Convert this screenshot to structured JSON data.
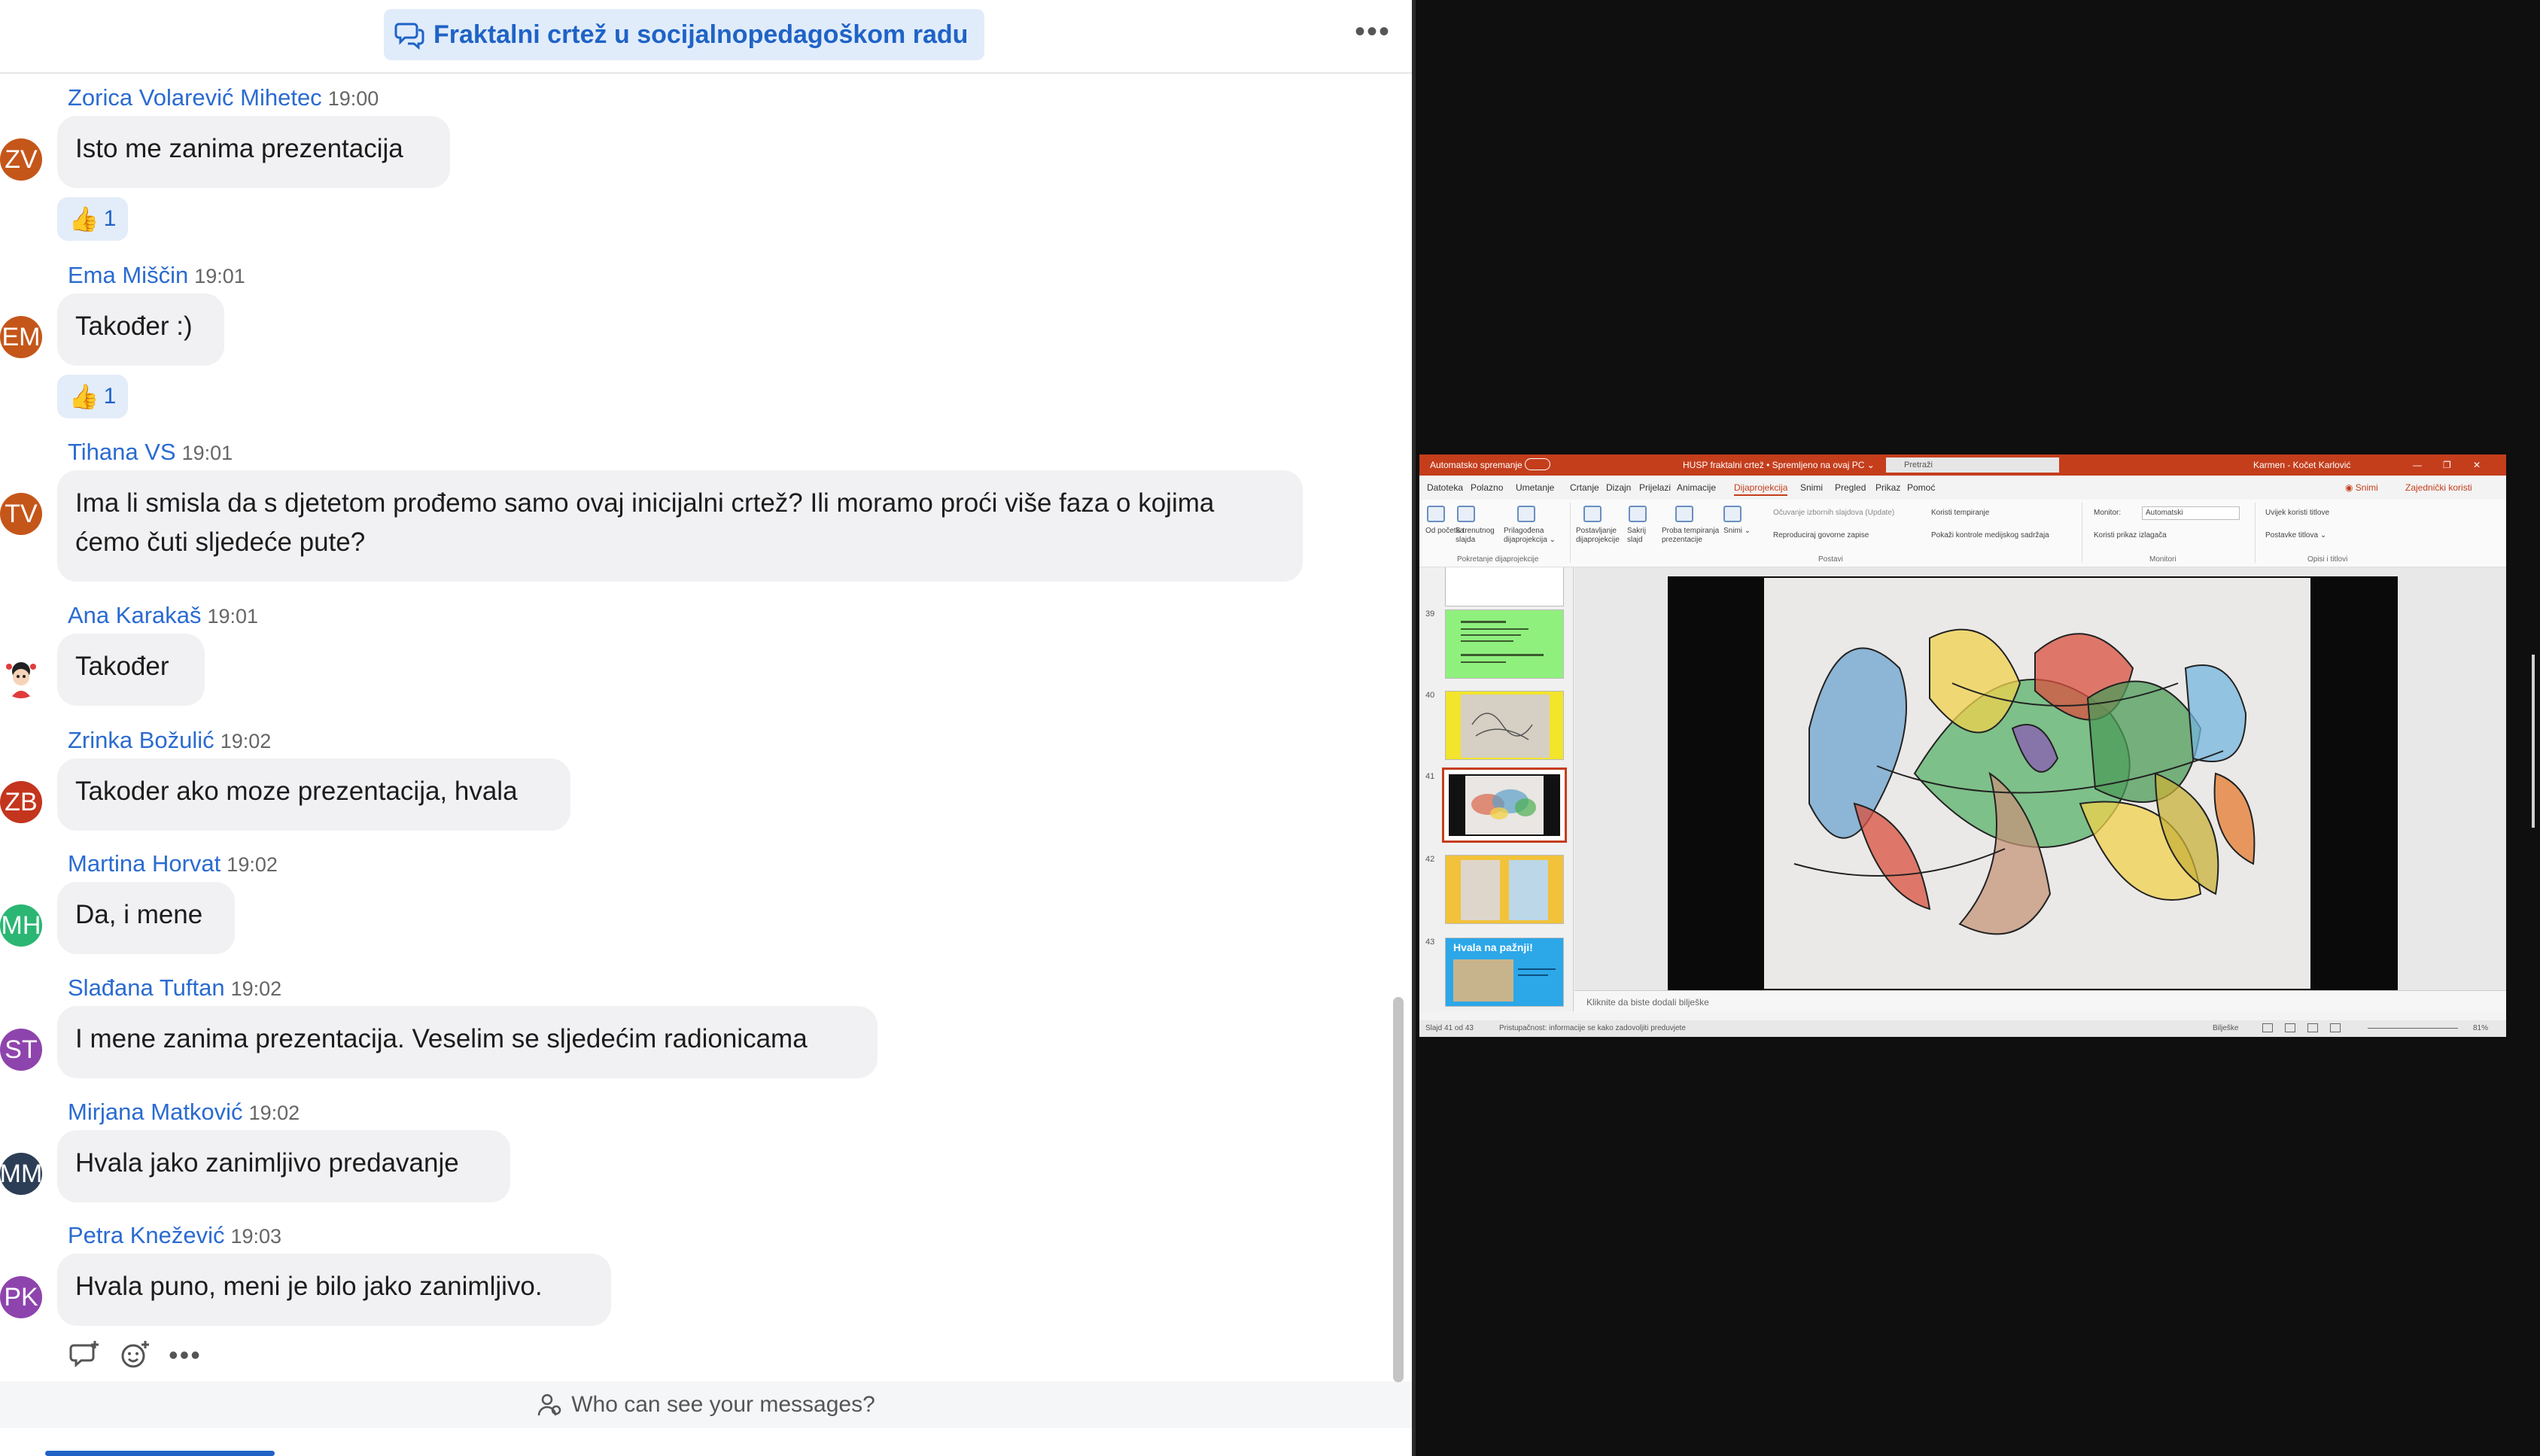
{
  "chat": {
    "title": "Fraktalni crtež u socijalnopedagoškom radu",
    "more": "•••",
    "messages": [
      {
        "name": "Zorica Volarević Mihetec",
        "time": "19:00",
        "initials": "ZV",
        "color": "#c5561a",
        "text": "Isto me zanima prezentacija",
        "reaction": {
          "emoji": "👍",
          "count": "1"
        }
      },
      {
        "name": "Ema Miščin",
        "time": "19:01",
        "initials": "EM",
        "color": "#c5561a",
        "text": "Također :)",
        "reaction": {
          "emoji": "👍",
          "count": "1"
        }
      },
      {
        "name": "Tihana VS",
        "time": "19:01",
        "initials": "TV",
        "color": "#c5561a",
        "text": "Ima li smisla da s djetetom prođemo samo ovaj inicijalni crtež? Ili moramo proći više faza  o kojima ćemo čuti sljedeće pute?"
      },
      {
        "name": "Ana Karakaš",
        "time": "19:01",
        "initials": "",
        "color": "#ffffff",
        "text": "Također"
      },
      {
        "name": "Zrinka Božulić",
        "time": "19:02",
        "initials": "ZB",
        "color": "#c4351e",
        "text": "Takoder ako moze prezentacija, hvala"
      },
      {
        "name": "Martina Horvat",
        "time": "19:02",
        "initials": "MH",
        "color": "#2bb673",
        "text": "Da, i mene"
      },
      {
        "name": "Slađana Tuftan",
        "time": "19:02",
        "initials": "ST",
        "color": "#8e44ad",
        "text": "I mene zanima prezentacija. Veselim se sljedećim radionicama"
      },
      {
        "name": "Mirjana Matković",
        "time": "19:02",
        "initials": "MM",
        "color": "#2c3e55",
        "text": "Hvala jako zanimljivo predavanje"
      },
      {
        "name": "Petra Knežević",
        "time": "19:03",
        "initials": "PK",
        "color": "#8e44ad",
        "text": "Hvala puno,  meni je bilo jako zanimljivo."
      }
    ],
    "action_more": "•••",
    "footer_text": "Who can see your messages?"
  },
  "ppt": {
    "titlebar": {
      "autosave": "Automatsko spremanje",
      "doc": "HUSP fraktalni crtež • Spremljeno na ovaj PC ⌄",
      "search": "Pretraži",
      "user": "Karmen - Kočet Karlović"
    },
    "menu": [
      "Datoteka",
      "Polazno",
      "Umetanje",
      "Crtanje",
      "Dizajn",
      "Prijelazi",
      "Animacije",
      "Dijaprojekcija",
      "Snimi",
      "Pregled",
      "Prikaz",
      "Pomoć"
    ],
    "menu_right": {
      "record": "◉ Snimi",
      "share": "Zajednički koristi"
    },
    "ribbon": {
      "start_items": [
        "Od početka",
        "S trenutnog slajda",
        "Prilagođena dijaprojekcija ⌄"
      ],
      "setup_items": [
        "Postavljanje dijaprojekcije",
        "Sakrij slajd",
        "Proba tempiranja prezentacije",
        "Snimi ⌄"
      ],
      "checks": [
        "Očuvanje izbornih slajdova (Update)",
        "Reproduciraj govorne zapise",
        "Koristi tempiranje",
        "Pokaži kontrole medijskog sadržaja"
      ],
      "monitor_label": "Monitor:",
      "monitor_value": "Automatski",
      "presenter": "Koristi prikaz izlagača",
      "subtitles": [
        "Uvijek koristi titlove",
        "Postavke titlova ⌄"
      ],
      "groups": [
        "Pokretanje dijaprojekcije",
        "Postavi",
        "Monitori",
        "Opisi i titlovi"
      ]
    },
    "thumbs": [
      "39",
      "40",
      "41",
      "42",
      "43"
    ],
    "thumb43_title": "Hvala na pažnji!",
    "notes_placeholder": "Kliknite da biste dodali bilješke",
    "status": {
      "slide": "Slajd 41 od 43",
      "access": "Pristupačnost: informacije se kako zadovoljiti preduvjete",
      "notes_btn": "Bilješke",
      "zoom": "81%"
    }
  }
}
